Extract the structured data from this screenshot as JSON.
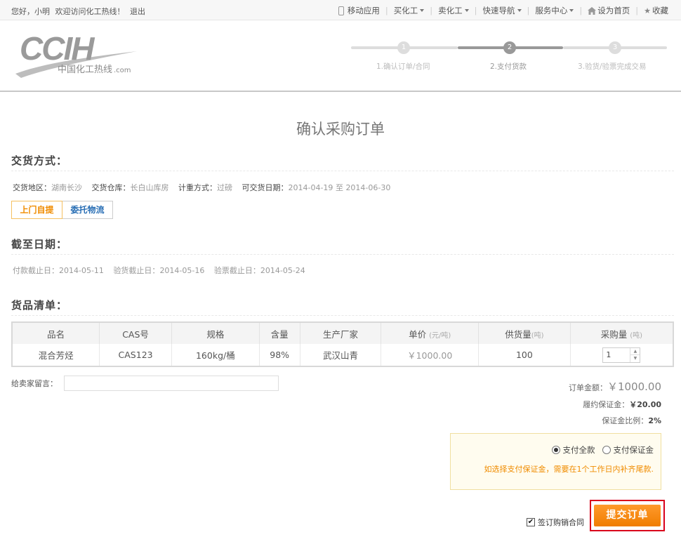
{
  "topbar": {
    "greeting_hello": "您好，小明",
    "greeting_welcome": "欢迎访问化工热线！",
    "logout": "退出",
    "mobile": "移动应用",
    "buy": "买化工",
    "sell": "卖化工",
    "quicknav": "快速导航",
    "service": "服务中心",
    "set_home": "设为首页",
    "favorite": "收藏"
  },
  "logo": {
    "main": "CCIH",
    "sub": "中国化工热线",
    "suffix": ".com"
  },
  "steps": [
    {
      "num": "1",
      "label": "1.确认订单/合同"
    },
    {
      "num": "2",
      "label": "2.支付货款"
    },
    {
      "num": "3",
      "label": "3.验货/验票完成交易"
    }
  ],
  "page_title": "确认采购订单",
  "delivery": {
    "section_title": "交货方式：",
    "region_label": "交货地区：",
    "region": "湖南长沙",
    "warehouse_label": "交货仓库：",
    "warehouse": "长白山库房",
    "measure_label": "计重方式：",
    "measure": "过磅",
    "date_label": "可交货日期：",
    "date_from": "2014-04-19",
    "date_to_word": "至",
    "date_to": "2014-06-30",
    "option_pickup": "上门自提",
    "option_logistics": "委托物流"
  },
  "deadline": {
    "section_title": "截至日期：",
    "pay_label": "付款截止日：",
    "pay": "2014-05-11",
    "inspect_label": "验货截止日：",
    "inspect": "2014-05-16",
    "invoice_label": "验票截止日：",
    "invoice": "2014-05-24"
  },
  "goods": {
    "section_title": "货品清单：",
    "headers": {
      "name": "品名",
      "cas": "CAS号",
      "spec": "规格",
      "content": "含量",
      "maker": "生产厂家",
      "price": "单价",
      "price_unit": "(元/吨)",
      "supply": "供货量",
      "supply_unit": "(吨)",
      "qty": "采购量",
      "qty_unit": "(吨)"
    },
    "row": {
      "name": "混合芳烃",
      "cas": "CAS123",
      "spec": "160kg/桶",
      "content": "98%",
      "maker": "武汉山青",
      "price": "￥1000.00",
      "supply": "100",
      "qty": "1"
    }
  },
  "memo": {
    "label": "给卖家留言：",
    "value": ""
  },
  "summary": {
    "total_label": "订单金额：",
    "total": "￥1000.00",
    "deposit_label": "履约保证金：",
    "deposit": "￥20.00",
    "ratio_label": "保证金比例：",
    "ratio": "2%"
  },
  "payment": {
    "full": "支付全款",
    "deposit": "支付保证金",
    "note": "如选择支付保证金，需要在1个工作日内补齐尾款."
  },
  "agree_label": "签订购销合同",
  "submit_label": "提交订单"
}
